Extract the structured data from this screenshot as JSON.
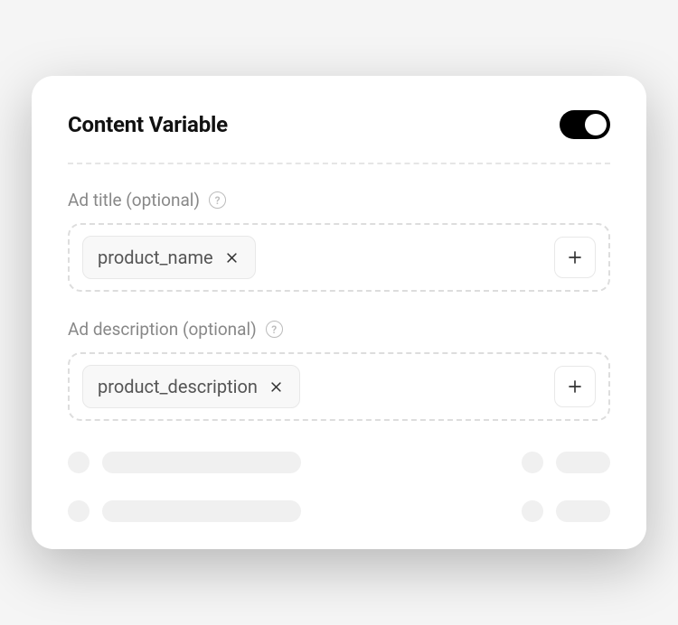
{
  "header": {
    "title": "Content Variable",
    "toggle_on": true
  },
  "fields": [
    {
      "label": "Ad title (optional)",
      "chip": "product_name"
    },
    {
      "label": "Ad description (optional)",
      "chip": "product_description"
    }
  ]
}
